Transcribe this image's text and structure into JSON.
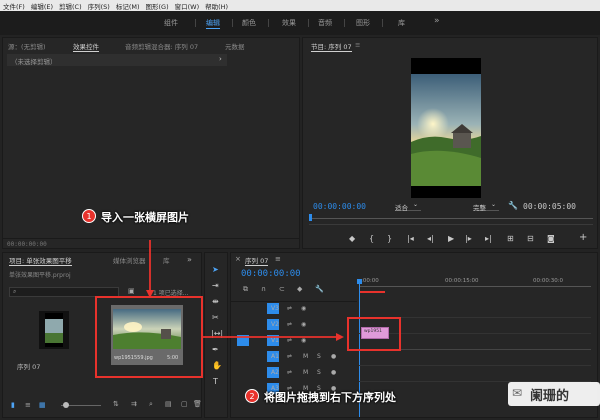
{
  "menu": [
    "文件(F)",
    "编辑(E)",
    "剪辑(C)",
    "序列(S)",
    "标记(M)",
    "图形(G)",
    "窗口(W)",
    "帮助(H)"
  ],
  "workspaces": [
    "组件",
    "编辑",
    "颜色",
    "效果",
    "音频",
    "图形",
    "库"
  ],
  "workspace_more": "»",
  "source_panel": {
    "tabs": [
      "源：(无剪辑)",
      "效果控件",
      "音频剪辑混合器: 序列 07",
      "元数据"
    ],
    "no_clip_text": "（未选择剪辑）",
    "timecode": "00:00:00:00"
  },
  "program_panel": {
    "title": "节目: 序列 07",
    "menu_icon": "≡",
    "timecode": "00:00:00:00",
    "fit": "适合",
    "quality": "完整",
    "duration": "00:00:05:00"
  },
  "project_panel": {
    "tabs": [
      "项目: 单张效果图平移",
      "媒体浏览器",
      "库"
    ],
    "project_file": "单张效果图平移.prproj",
    "selection_info": "1 项已选择...",
    "items": [
      {
        "name": "序列 07",
        "duration": ""
      },
      {
        "name": "wp1951559.jpg",
        "duration": "5:00"
      }
    ]
  },
  "timeline": {
    "title": "序列 07",
    "timecode": "00:00:00:00",
    "ruler": [
      ":00:00",
      "00:00:15:00",
      "00:00:30:0"
    ],
    "video_tracks": [
      "V3",
      "V2",
      "V1"
    ],
    "audio_tracks": [
      "A1",
      "A2",
      "A3"
    ],
    "clip_label": "wp1951"
  },
  "annotations": {
    "step1": {
      "number": "1",
      "text": "导入一张横屏图片"
    },
    "step2": {
      "number": "2",
      "text": "将图片拖拽到右下方序列处"
    }
  },
  "watermark": "阑珊的",
  "colors": {
    "accent": "#2d8ceb",
    "annotation": "#e8322c",
    "clip": "#e09ad9"
  }
}
